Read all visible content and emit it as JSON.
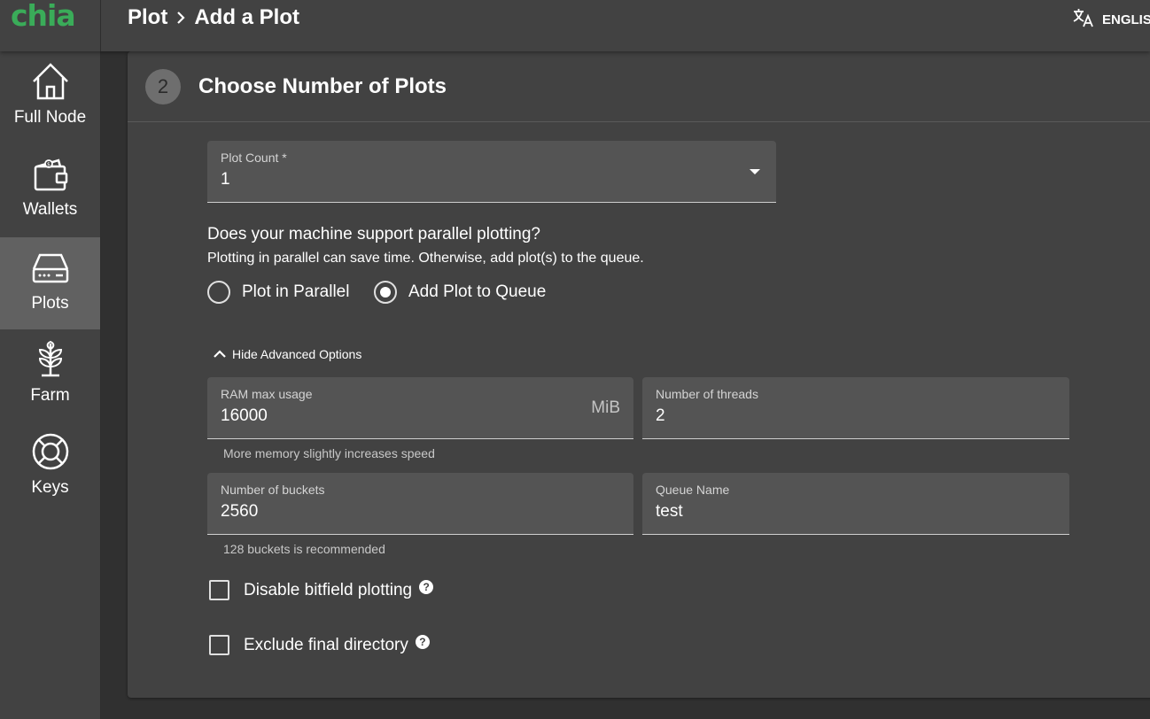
{
  "app": {
    "logo": "chia",
    "breadcrumb": {
      "section": "Plot",
      "page": "Add a Plot"
    },
    "language": "ENGLISH",
    "brand_color": "#3aac59"
  },
  "sidebar": {
    "items": [
      {
        "label": "Full Node",
        "icon": "home-icon",
        "active": false
      },
      {
        "label": "Wallets",
        "icon": "wallet-icon",
        "active": false
      },
      {
        "label": "Plots",
        "icon": "hard-drive-icon",
        "active": true
      },
      {
        "label": "Farm",
        "icon": "sprout-icon",
        "active": false
      },
      {
        "label": "Keys",
        "icon": "lifebuoy-icon",
        "active": false
      }
    ]
  },
  "step": {
    "number": "2",
    "title": "Choose Number of Plots"
  },
  "plot_count": {
    "label": "Plot Count *",
    "value": "1"
  },
  "parallel": {
    "question": "Does your machine support parallel plotting?",
    "subtext": "Plotting in parallel can save time. Otherwise, add plot(s) to the queue.",
    "options": [
      {
        "label": "Plot in Parallel",
        "selected": false
      },
      {
        "label": "Add Plot to Queue",
        "selected": true
      }
    ]
  },
  "advanced": {
    "toggle_label": "Hide Advanced Options",
    "ram": {
      "label": "RAM max usage",
      "value": "16000",
      "unit": "MiB",
      "helper": "More memory slightly increases speed"
    },
    "threads": {
      "label": "Number of threads",
      "value": "2"
    },
    "buckets": {
      "label": "Number of buckets",
      "value": "2560",
      "helper": "128 buckets is recommended"
    },
    "queue": {
      "label": "Queue Name",
      "value": "test"
    },
    "checkboxes": [
      {
        "label": "Disable bitfield plotting",
        "checked": false,
        "help": "?"
      },
      {
        "label": "Exclude final directory",
        "checked": false,
        "help": "?"
      }
    ]
  }
}
